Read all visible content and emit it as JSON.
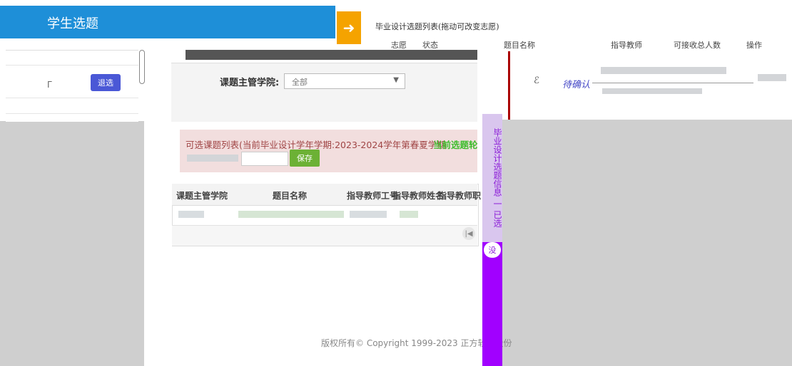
{
  "header": {
    "title": "学生选题"
  },
  "wish_panel": {
    "title": "毕业设计选题列表(拖动可改变志愿)",
    "columns": [
      "志愿",
      "状态",
      "题目名称",
      "指导教师",
      "可接收总人数",
      "操作"
    ]
  },
  "left_panel": {
    "withdraw_label": "退选"
  },
  "filter": {
    "college_label": "课题主管学院:",
    "college_value": "全部"
  },
  "available": {
    "text": "可选课题列表(当前毕业设计学年学期:2023-2024学年第春夏学期",
    "round_text": "当前选题轮",
    "save_label": "保存"
  },
  "table": {
    "headers": [
      "课题主管学院",
      "题目名称",
      "指导教师工号",
      "指导教师姓名",
      "指导教师职"
    ],
    "pager_first": "|◀"
  },
  "footer": {
    "copyright": "版权所有© Copyright 1999-2023 正方软件股份"
  },
  "side_strip": {
    "text": "毕业设计选题信息 一 已选",
    "circle": "没"
  },
  "confirm": {
    "status": "待确认"
  },
  "colors": {
    "header_blue": "#1e8fd8",
    "arrow_orange": "#f5a300",
    "purple": "#a100ff",
    "save_green": "#6cb135",
    "withdraw_blue": "#4a58d6"
  }
}
